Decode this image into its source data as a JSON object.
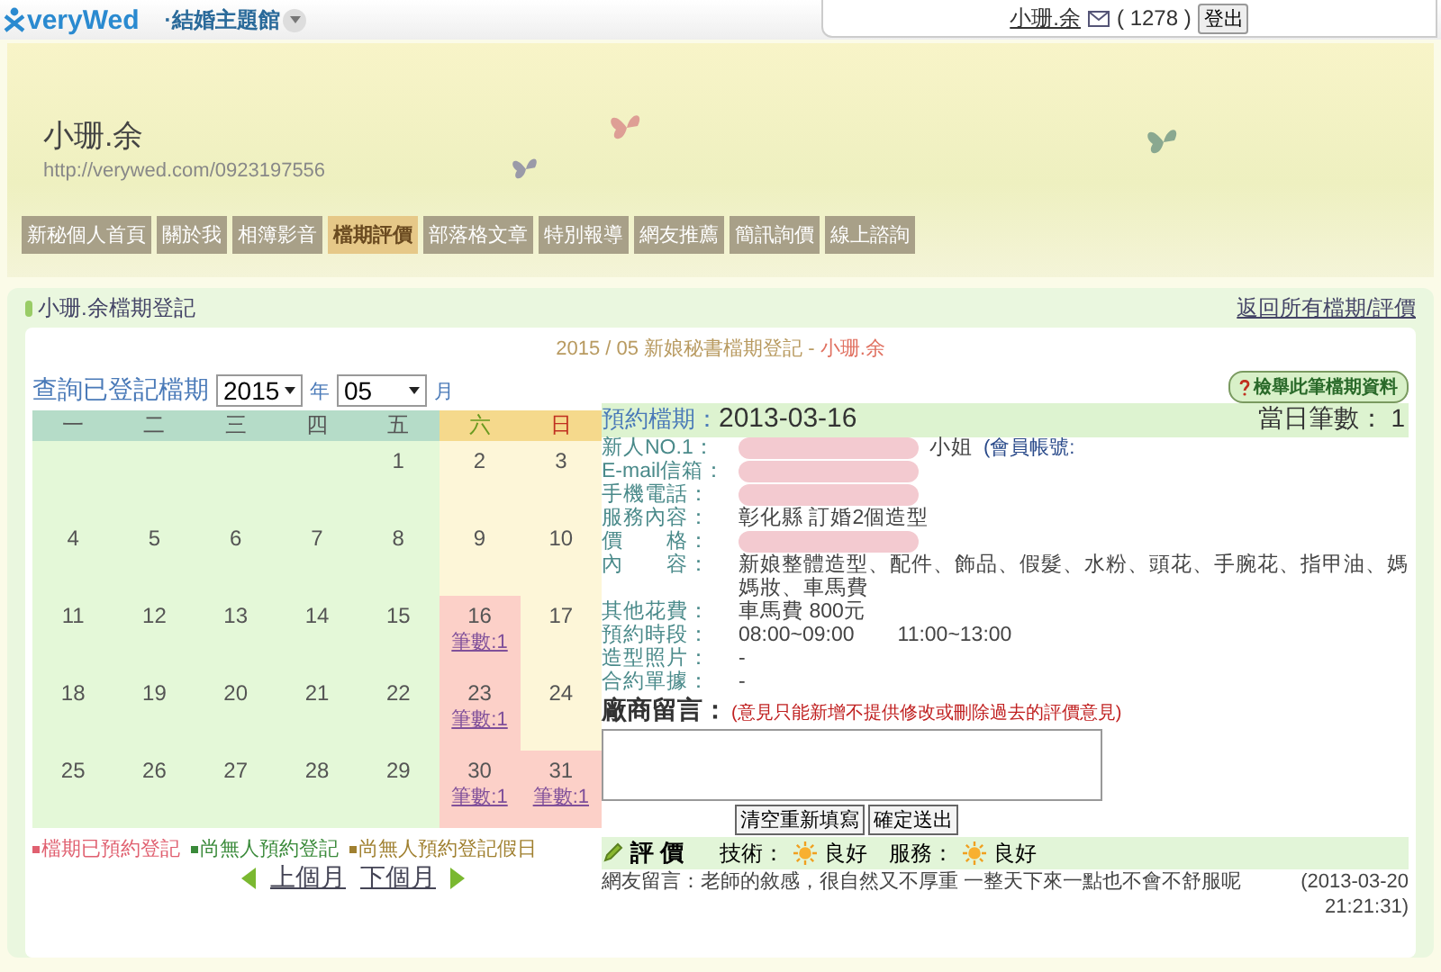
{
  "topbar": {
    "logo": "veryWed",
    "section": "·結婚主題館",
    "user": "小珊.余",
    "count": "( 1278 )",
    "logout": "登出"
  },
  "banner": {
    "name": "小珊.余",
    "url": "http://verywed.com/0923197556"
  },
  "nav": [
    {
      "label": "新秘個人首頁",
      "selected": false
    },
    {
      "label": "關於我",
      "selected": false
    },
    {
      "label": "相簿影音",
      "selected": false
    },
    {
      "label": "檔期評價",
      "selected": true
    },
    {
      "label": "部落格文章",
      "selected": false
    },
    {
      "label": "特別報導",
      "selected": false
    },
    {
      "label": "網友推薦",
      "selected": false
    },
    {
      "label": "簡訊詢價",
      "selected": false
    },
    {
      "label": "線上諮詢",
      "selected": false
    }
  ],
  "panel": {
    "title": "小珊.余檔期登記",
    "back_link": "返回所有檔期/評價",
    "heading_date": "2015 / 05 新娘秘書檔期登記 - ",
    "heading_name": "小珊.余"
  },
  "query": {
    "label": "查詢已登記檔期",
    "year": "2015",
    "year_unit": "年",
    "month": "05",
    "month_unit": "月"
  },
  "calendar": {
    "weekdays": [
      {
        "label": "一",
        "kind": "weekday"
      },
      {
        "label": "二",
        "kind": "weekday"
      },
      {
        "label": "三",
        "kind": "weekday"
      },
      {
        "label": "四",
        "kind": "weekday"
      },
      {
        "label": "五",
        "kind": "weekday"
      },
      {
        "label": "六",
        "kind": "saturday"
      },
      {
        "label": "日",
        "kind": "sunday"
      }
    ],
    "weeks": [
      [
        {
          "kind": "empty"
        },
        {
          "kind": "empty"
        },
        {
          "kind": "empty"
        },
        {
          "kind": "empty"
        },
        {
          "day": "1",
          "kind": "open"
        },
        {
          "day": "2",
          "kind": "holiday"
        },
        {
          "day": "3",
          "kind": "holiday"
        }
      ],
      [
        {
          "day": "4",
          "kind": "open"
        },
        {
          "day": "5",
          "kind": "open"
        },
        {
          "day": "6",
          "kind": "open"
        },
        {
          "day": "7",
          "kind": "open"
        },
        {
          "day": "8",
          "kind": "open"
        },
        {
          "day": "9",
          "kind": "holiday"
        },
        {
          "day": "10",
          "kind": "holiday"
        }
      ],
      [
        {
          "day": "11",
          "kind": "open"
        },
        {
          "day": "12",
          "kind": "open"
        },
        {
          "day": "13",
          "kind": "open"
        },
        {
          "day": "14",
          "kind": "open"
        },
        {
          "day": "15",
          "kind": "open"
        },
        {
          "day": "16",
          "kind": "booked",
          "count": "筆數:1"
        },
        {
          "day": "17",
          "kind": "holiday"
        }
      ],
      [
        {
          "day": "18",
          "kind": "open"
        },
        {
          "day": "19",
          "kind": "open"
        },
        {
          "day": "20",
          "kind": "open"
        },
        {
          "day": "21",
          "kind": "open"
        },
        {
          "day": "22",
          "kind": "open"
        },
        {
          "day": "23",
          "kind": "booked",
          "count": "筆數:1"
        },
        {
          "day": "24",
          "kind": "holiday"
        }
      ],
      [
        {
          "day": "25",
          "kind": "open"
        },
        {
          "day": "26",
          "kind": "open"
        },
        {
          "day": "27",
          "kind": "open"
        },
        {
          "day": "28",
          "kind": "open"
        },
        {
          "day": "29",
          "kind": "open"
        },
        {
          "day": "30",
          "kind": "booked",
          "count": "筆數:1"
        },
        {
          "day": "31",
          "kind": "booked",
          "count": "筆數:1"
        }
      ]
    ],
    "legend": [
      {
        "label": "檔期已預約登記",
        "color": "#e06070"
      },
      {
        "label": "尚無人預約登記",
        "color": "#3a8a3a"
      },
      {
        "label": "尚無人預約登記假日",
        "color": "#a08030"
      }
    ],
    "prev": "上個月",
    "next": "下個月"
  },
  "detail": {
    "report_button": "檢舉此筆檔期資料",
    "date_label": "預約檔期：",
    "date": "2013-03-16",
    "day_count": "當日筆數： 1",
    "rows": [
      {
        "label": "新人NO.1：",
        "value": "小姐",
        "note": "(會員帳號:",
        "redacted": true
      },
      {
        "label": "E-mail信箱：",
        "redacted": true
      },
      {
        "label": "手機電話：",
        "redacted": true
      },
      {
        "label": "服務內容：",
        "value": "彰化縣 訂婚2個造型"
      },
      {
        "label": "價　　格：",
        "redacted": true
      },
      {
        "label": "內　　容：",
        "value": "新娘整體造型、配件、飾品、假髮、水粉、頭花、手腕花、指甲油、媽媽妝、車馬費"
      },
      {
        "label": "其他花費：",
        "value": "車馬費 800元"
      },
      {
        "label": "預約時段：",
        "value": "08:00~09:00　　11:00~13:00"
      },
      {
        "label": "造型照片：",
        "value": "-"
      },
      {
        "label": "合約單據：",
        "value": "-"
      }
    ],
    "vendor_label": "廠商留言：",
    "vendor_note": "(意見只能新增不提供修改或刪除過去的評價意見)",
    "clear_button": "清空重新填寫",
    "submit_button": "確定送出",
    "review": {
      "title": "評 價",
      "ratings": [
        {
          "label": "技術：",
          "value": "良好"
        },
        {
          "label": "服務：",
          "value": "良好"
        }
      ],
      "comment": "網友留言：老師的敘感，很自然又不厚重 一整天下來一點也不會不舒服呢",
      "date": "(2013-03-20 21:21:31)"
    }
  }
}
